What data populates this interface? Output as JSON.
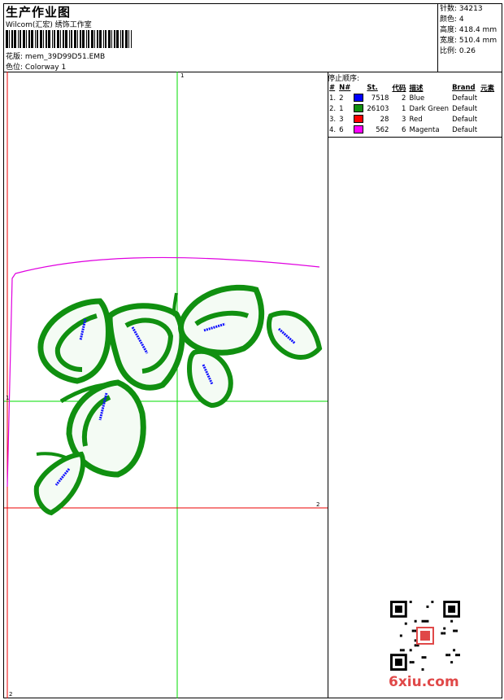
{
  "header": {
    "title": "生产作业图",
    "subtitle": "Wilcom(汇宏) 绣饰工作室",
    "design_label": "花版:",
    "design_file": "mem_39D99D51.EMB",
    "colorway_label": "色位:",
    "colorway": "Colorway 1"
  },
  "stats": [
    {
      "label": "针数:",
      "value": "34213"
    },
    {
      "label": "颜色:",
      "value": "4"
    },
    {
      "label": "高度:",
      "value": "418.4 mm"
    },
    {
      "label": "宽度:",
      "value": "510.4 mm"
    },
    {
      "label": "比例:",
      "value": "0.26"
    }
  ],
  "stop_sequence": {
    "title": "停止顺序:",
    "headers": {
      "index": "#",
      "number": "N#",
      "stitches": "St.",
      "code": "代码",
      "description": "描述",
      "brand": "Brand",
      "element": "元素"
    },
    "rows": [
      {
        "index": "1.",
        "number": "2",
        "color": "#0000ff",
        "stitches": "7518",
        "code": "2",
        "description": "Blue",
        "brand": "Default"
      },
      {
        "index": "2.",
        "number": "1",
        "color": "#109010",
        "stitches": "26103",
        "code": "1",
        "description": "Dark Green",
        "brand": "Default"
      },
      {
        "index": "3.",
        "number": "3",
        "color": "#ff0000",
        "stitches": "28",
        "code": "3",
        "description": "Red",
        "brand": "Default"
      },
      {
        "index": "4.",
        "number": "6",
        "color": "#ff00ff",
        "stitches": "562",
        "code": "6",
        "description": "Magenta",
        "brand": "Default"
      }
    ]
  },
  "axes": {
    "top": "1",
    "left": "1",
    "right": "2",
    "bottom": "2"
  },
  "watermark": "6xiu.com",
  "colors": {
    "green_axis": "#00dd00",
    "red_axis": "#ee0000",
    "outline": "#e000e0",
    "stitch_green": "#109010",
    "stitch_blue": "#1010ff"
  }
}
